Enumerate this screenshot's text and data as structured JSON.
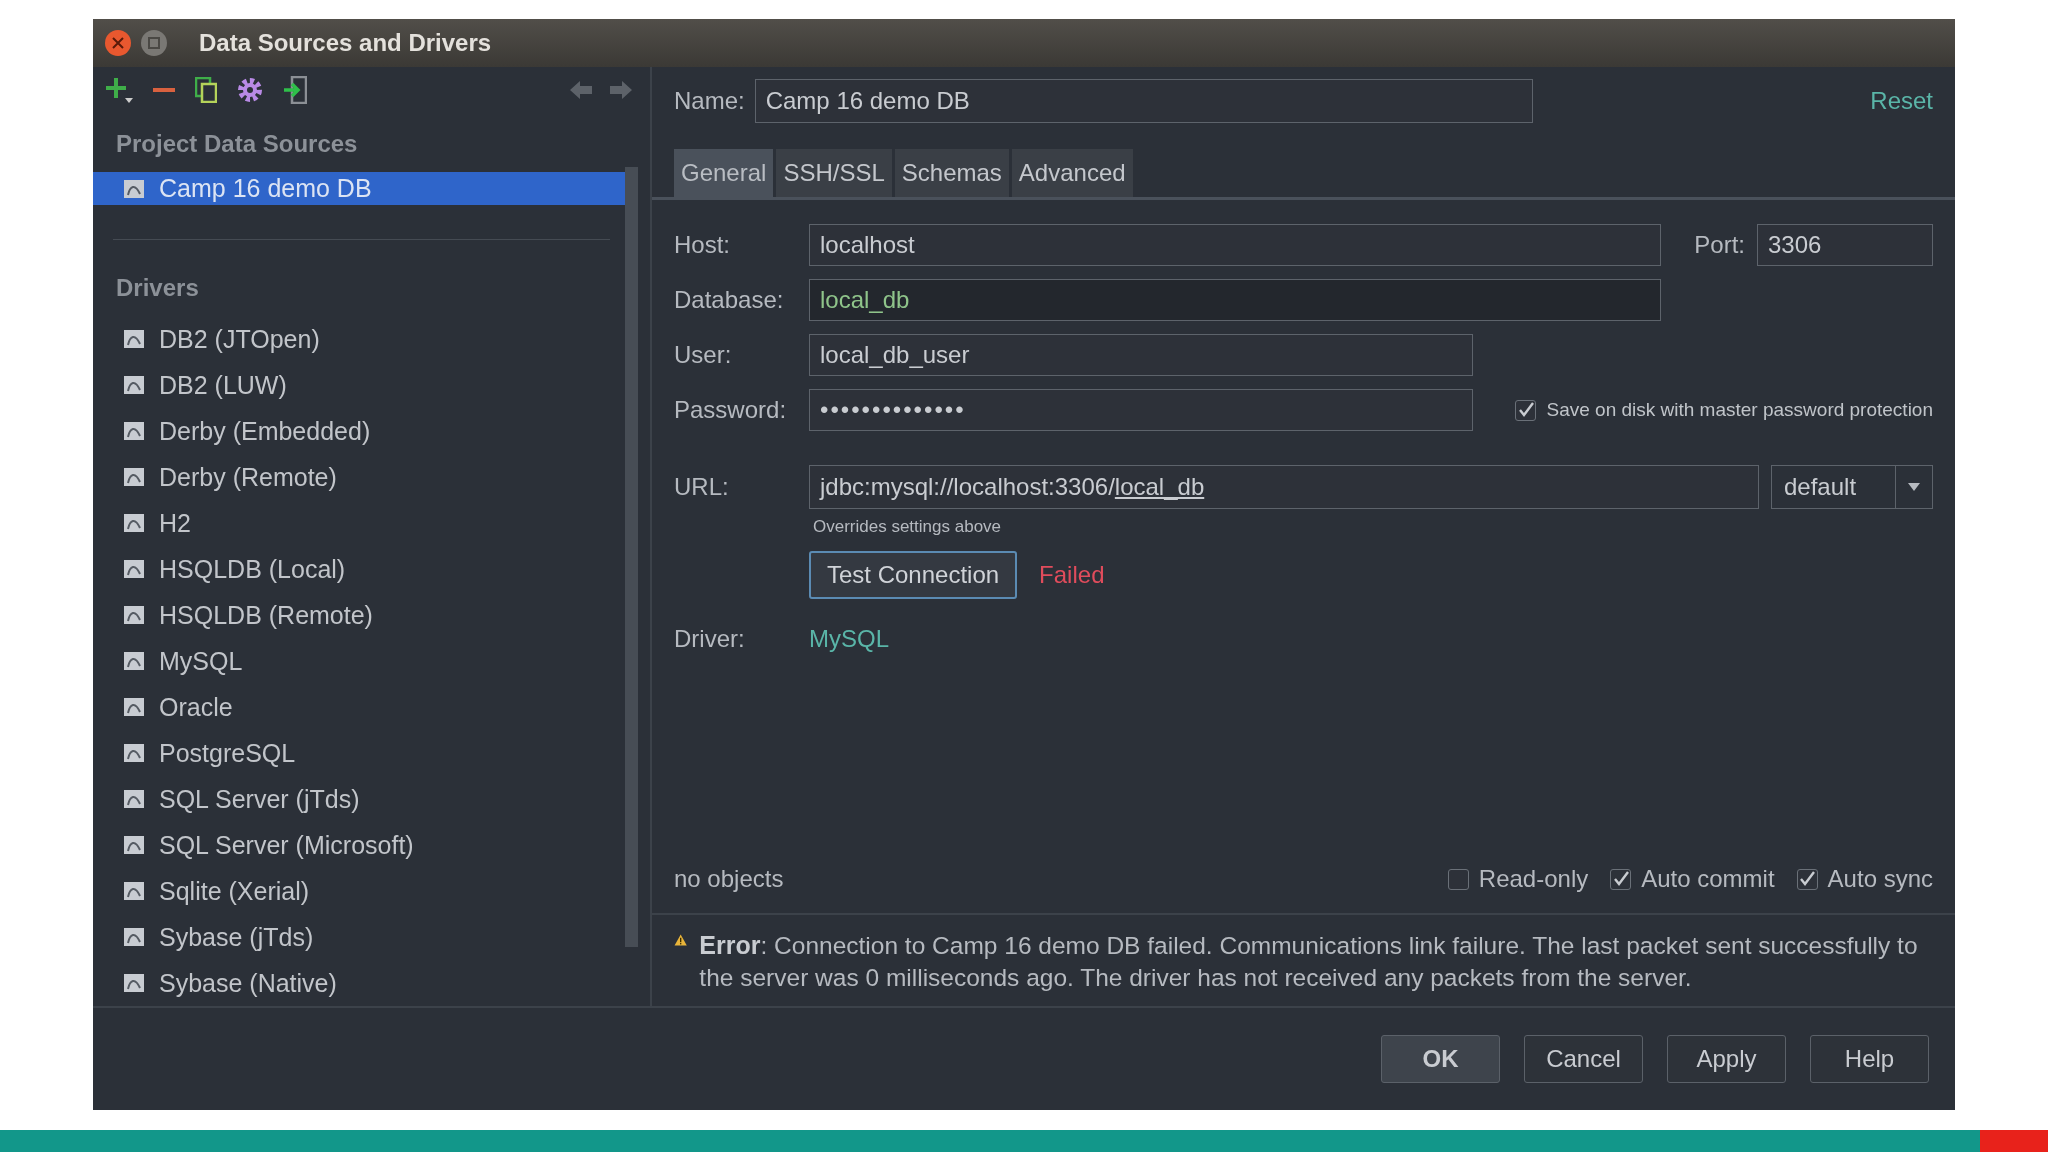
{
  "window": {
    "title": "Data Sources and Drivers"
  },
  "sidebar": {
    "section_title": "Project Data Sources",
    "data_sources": [
      {
        "label": "Camp 16 demo DB",
        "selected": true
      }
    ],
    "drivers_title": "Drivers",
    "drivers": [
      {
        "label": "DB2 (JTOpen)",
        "selected": false
      },
      {
        "label": "DB2 (LUW)",
        "selected": false
      },
      {
        "label": "Derby (Embedded)",
        "selected": false
      },
      {
        "label": "Derby (Remote)",
        "selected": false
      },
      {
        "label": "H2",
        "selected": false
      },
      {
        "label": "HSQLDB (Local)",
        "selected": false
      },
      {
        "label": "HSQLDB (Remote)",
        "selected": false
      },
      {
        "label": "MySQL",
        "selected": false
      },
      {
        "label": "Oracle",
        "selected": false
      },
      {
        "label": "PostgreSQL",
        "selected": false
      },
      {
        "label": "SQL Server (jTds)",
        "selected": false
      },
      {
        "label": "SQL Server (Microsoft)",
        "selected": false
      },
      {
        "label": "Sqlite (Xerial)",
        "selected": false
      },
      {
        "label": "Sybase (jTds)",
        "selected": false
      },
      {
        "label": "Sybase (Native)",
        "selected": false
      }
    ]
  },
  "name": {
    "label": "Name:",
    "value": "Camp 16 demo DB"
  },
  "reset_link": "Reset",
  "tabs": [
    {
      "label": "General",
      "selected": true
    },
    {
      "label": "SSH/SSL",
      "selected": false
    },
    {
      "label": "Schemas",
      "selected": false
    },
    {
      "label": "Advanced",
      "selected": false
    }
  ],
  "form": {
    "host": {
      "label": "Host:",
      "value": "localhost"
    },
    "port": {
      "label": "Port:",
      "value": "3306"
    },
    "database": {
      "label": "Database:",
      "value": "local_db"
    },
    "user": {
      "label": "User:",
      "value": "local_db_user"
    },
    "password": {
      "label": "Password:",
      "value": "••••••••••••••"
    },
    "save_password": {
      "label": "Save on disk with master password protection",
      "checked": true
    },
    "url": {
      "label": "URL:",
      "value": "jdbc:mysql://localhost:3306/",
      "linked_part": "local_db",
      "hint": "Overrides settings above"
    },
    "url_mode": "default",
    "test_button": "Test Connection",
    "test_status": "Failed",
    "driver": {
      "label": "Driver:",
      "value": "MySQL"
    }
  },
  "status": "no objects",
  "options": [
    {
      "label": "Read-only",
      "checked": false
    },
    {
      "label": "Auto commit",
      "checked": true
    },
    {
      "label": "Auto sync",
      "checked": true
    }
  ],
  "error": "**Error**: Connection to Camp 16 demo DB failed. Communications link failure. The last packet sent successfully to the server was 0 milliseconds ago. The driver has not received any packets from the server.",
  "buttons": [
    {
      "label": "OK",
      "kind": "default"
    },
    {
      "label": "Cancel",
      "kind": "normal"
    },
    {
      "label": "Apply",
      "kind": "normal"
    },
    {
      "label": "Help",
      "kind": "normal"
    }
  ]
}
